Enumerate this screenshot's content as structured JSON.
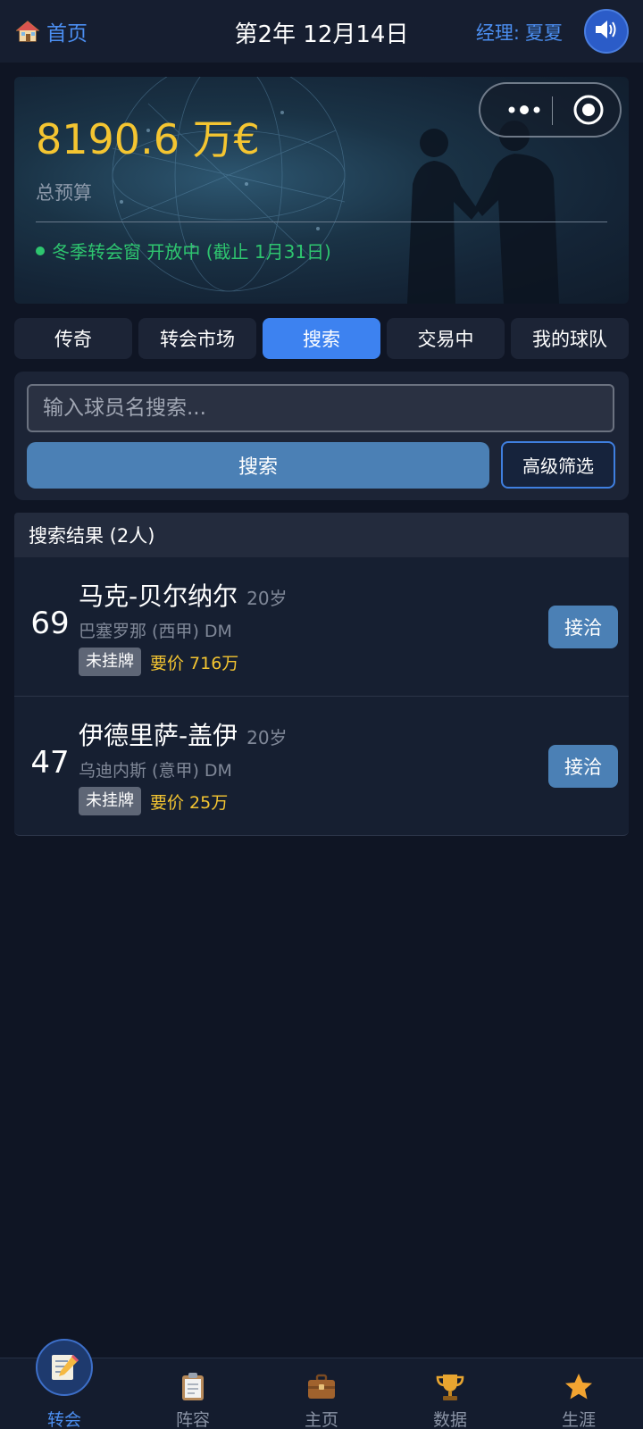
{
  "header": {
    "home_label": "首页",
    "date": "第2年 12月14日",
    "manager_label": "经理:",
    "manager_name": "夏夏",
    "icons": {
      "home": "house-icon",
      "sound": "speaker-icon"
    }
  },
  "banner": {
    "budget_value": "8190.6 万€",
    "budget_label": "总预算",
    "window_status": "冬季转会窗 开放中 (截止 1月31日)",
    "status_color": "#2ec56f",
    "capsule_icons": [
      "more-dots-icon",
      "close-target-icon"
    ]
  },
  "tabs": [
    {
      "label": "传奇",
      "active": false
    },
    {
      "label": "转会市场",
      "active": false
    },
    {
      "label": "搜索",
      "active": true
    },
    {
      "label": "交易中",
      "active": false
    },
    {
      "label": "我的球队",
      "active": false
    }
  ],
  "search": {
    "placeholder": "输入球员名搜索...",
    "value": "",
    "search_button": "搜索",
    "filter_button": "高级筛选"
  },
  "results": {
    "header": "搜索结果 (2人)",
    "players": [
      {
        "rating": "69",
        "name": "马克-贝尔纳尔",
        "age": "20岁",
        "club": "巴塞罗那 (西甲) DM",
        "status": "未挂牌",
        "price": "要价 716万",
        "action": "接洽"
      },
      {
        "rating": "47",
        "name": "伊德里萨-盖伊",
        "age": "20岁",
        "club": "乌迪内斯 (意甲) DM",
        "status": "未挂牌",
        "price": "要价 25万",
        "action": "接洽"
      }
    ]
  },
  "bottom_nav": [
    {
      "label": "转会",
      "icon": "memo-pencil-icon",
      "active": true
    },
    {
      "label": "阵容",
      "icon": "clipboard-icon",
      "active": false
    },
    {
      "label": "主页",
      "icon": "briefcase-icon",
      "active": false
    },
    {
      "label": "数据",
      "icon": "trophy-icon",
      "active": false
    },
    {
      "label": "生涯",
      "icon": "star-icon",
      "active": false
    }
  ],
  "colors": {
    "accent": "#3d82f0",
    "gold": "#f4c531",
    "button": "#4b80b5",
    "background": "#0f1524"
  }
}
